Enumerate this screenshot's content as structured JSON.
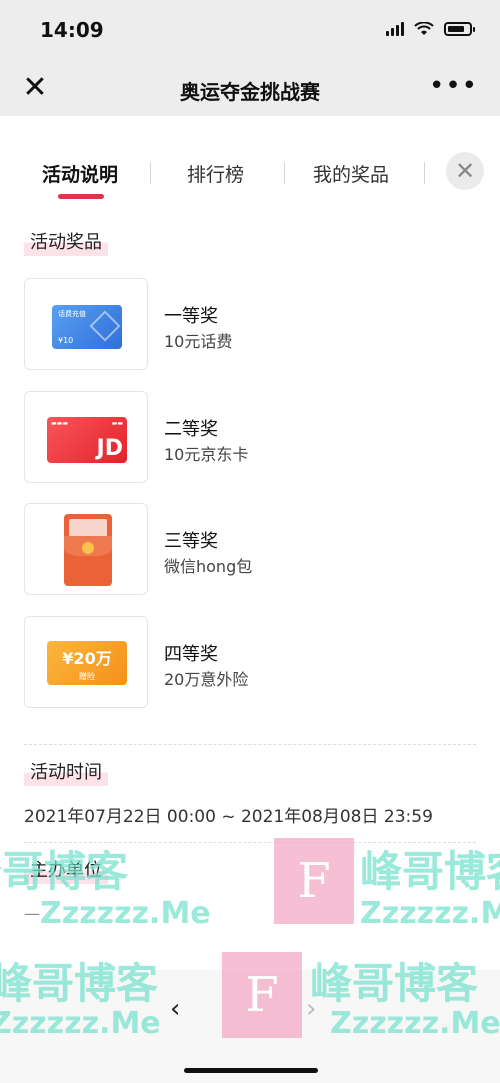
{
  "status": {
    "time": "14:09"
  },
  "header": {
    "title": "奥运夺金挑战赛",
    "close_icon": "close-icon",
    "more_icon": "more-icon"
  },
  "tabs": [
    {
      "label": "活动说明",
      "active": true
    },
    {
      "label": "排行榜",
      "active": false
    },
    {
      "label": "我的奖品",
      "active": false
    }
  ],
  "accent_color": "#e0344f",
  "prizes_section": {
    "title": "活动奖品",
    "items": [
      {
        "name": "一等奖",
        "desc": "10元话费",
        "card_label": "话费充值",
        "card_amount": "¥10"
      },
      {
        "name": "二等奖",
        "desc": "10元京东卡",
        "card_label": "JD"
      },
      {
        "name": "三等奖",
        "desc": "微信hong包"
      },
      {
        "name": "四等奖",
        "desc": "20万意外险",
        "card_amount": "¥20万",
        "card_label": "赠险"
      }
    ]
  },
  "time_section": {
    "title": "活动时间",
    "value": "2021年07月22日 00:00 ~ 2021年08月08日 23:59"
  },
  "organizer_section": {
    "title": "主办单位",
    "value": "—"
  },
  "watermark": {
    "text": "峰哥博客",
    "url": "Zzzzzz.Me",
    "letter": "F"
  }
}
